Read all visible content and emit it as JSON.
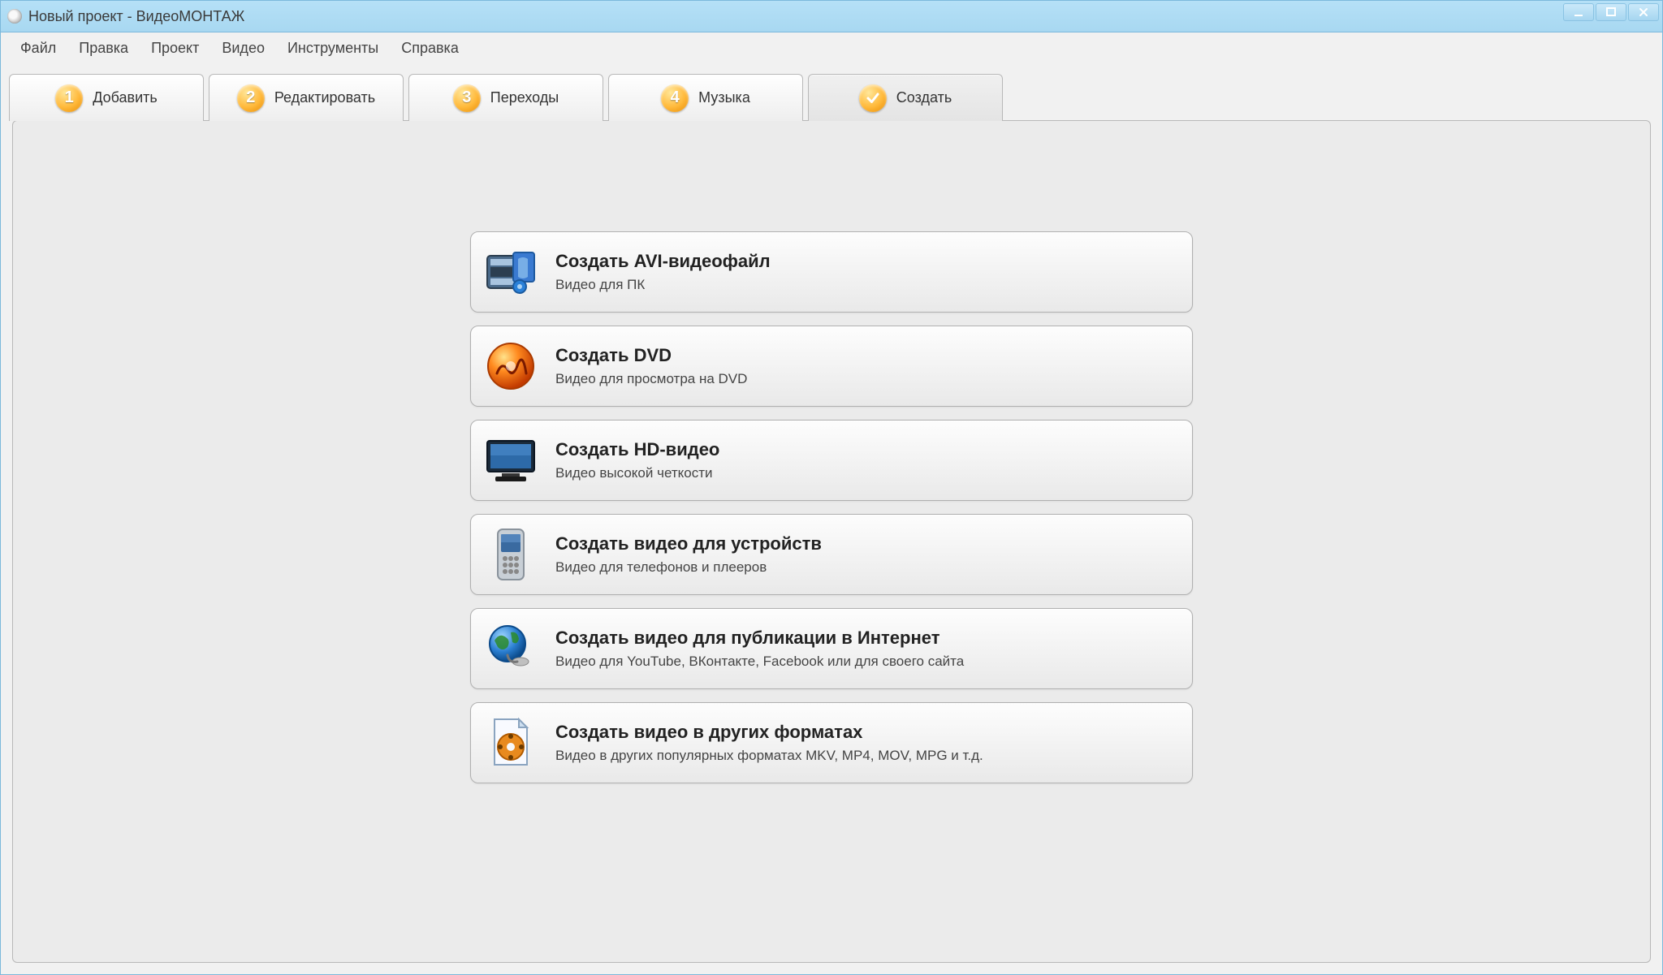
{
  "window": {
    "title": "Новый проект - ВидеоМОНТАЖ"
  },
  "menubar": {
    "items": [
      {
        "label": "Файл"
      },
      {
        "label": "Правка"
      },
      {
        "label": "Проект"
      },
      {
        "label": "Видео"
      },
      {
        "label": "Инструменты"
      },
      {
        "label": "Справка"
      }
    ]
  },
  "tabs": [
    {
      "num": "1",
      "label": "Добавить",
      "active": false,
      "type": "num"
    },
    {
      "num": "2",
      "label": "Редактировать",
      "active": false,
      "type": "num"
    },
    {
      "num": "3",
      "label": "Переходы",
      "active": false,
      "type": "num"
    },
    {
      "num": "4",
      "label": "Музыка",
      "active": false,
      "type": "num"
    },
    {
      "num": "",
      "label": "Создать",
      "active": true,
      "type": "check"
    }
  ],
  "options": [
    {
      "icon": "film-clip-icon",
      "title": "Создать AVI-видеофайл",
      "desc": "Видео для ПК"
    },
    {
      "icon": "disc-burn-icon",
      "title": "Создать DVD",
      "desc": "Видео для просмотра на DVD"
    },
    {
      "icon": "hd-monitor-icon",
      "title": "Создать HD-видео",
      "desc": "Видео высокой четкости"
    },
    {
      "icon": "phone-device-icon",
      "title": "Создать видео для устройств",
      "desc": "Видео для телефонов и плееров"
    },
    {
      "icon": "globe-internet-icon",
      "title": "Создать видео для публикации в Интернет",
      "desc": "Видео для YouTube, ВКонтакте, Facebook или для своего сайта"
    },
    {
      "icon": "file-format-icon",
      "title": "Создать видео в других форматах",
      "desc": "Видео в других популярных форматах MKV, MP4, MOV, MPG и т.д."
    }
  ]
}
